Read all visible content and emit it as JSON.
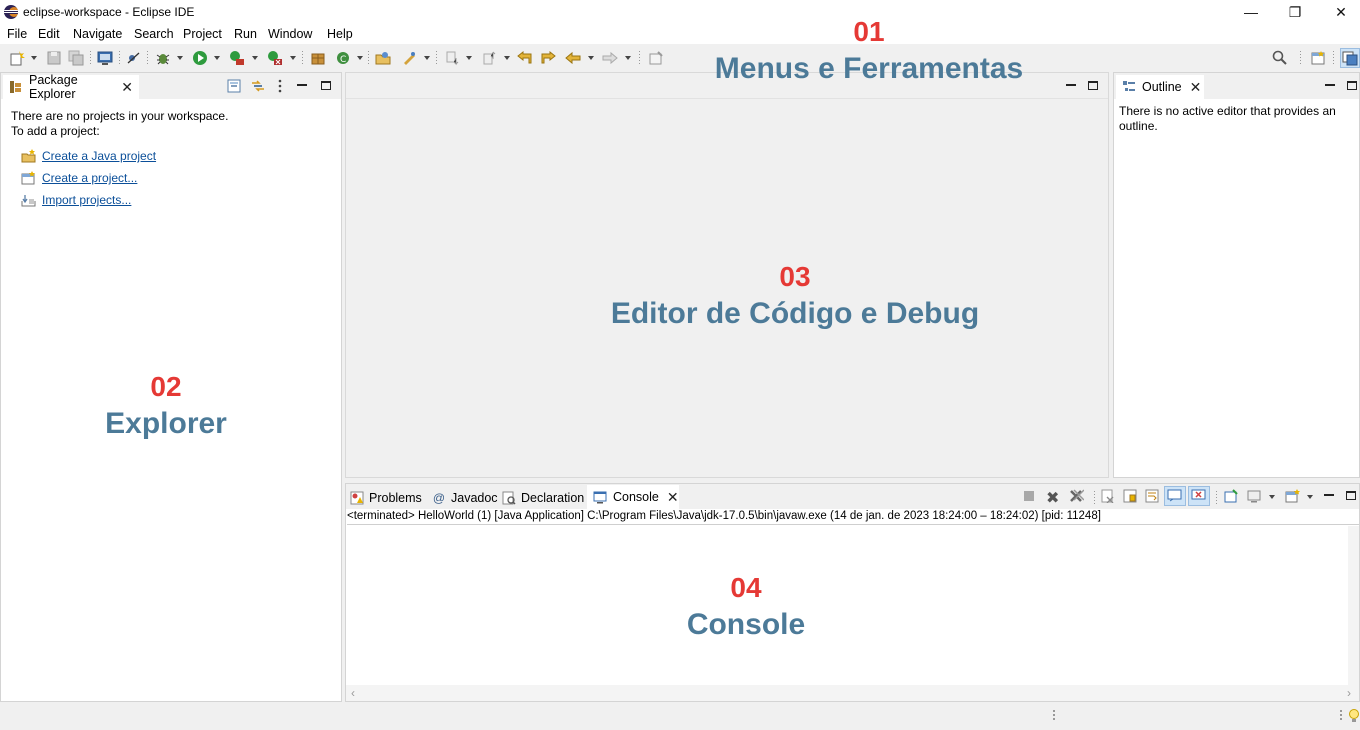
{
  "window": {
    "title": "eclipse-workspace - Eclipse IDE",
    "minimize_glyph": "—",
    "restore_glyph": "❐",
    "close_glyph": "✕"
  },
  "menu": [
    {
      "label": "File"
    },
    {
      "label": "Edit"
    },
    {
      "label": "Navigate"
    },
    {
      "label": "Search"
    },
    {
      "label": "Project"
    },
    {
      "label": "Run"
    },
    {
      "label": "Window"
    },
    {
      "label": "Help"
    }
  ],
  "package_explorer": {
    "tab_label": "Package Explorer",
    "message_line1": "There are no projects in your workspace.",
    "message_line2": "To add a project:",
    "links": [
      {
        "label": "Create a Java project",
        "icon": "new-java-project-icon"
      },
      {
        "label": "Create a project...",
        "icon": "new-project-icon"
      },
      {
        "label": "Import projects...",
        "icon": "import-icon"
      }
    ]
  },
  "outline": {
    "tab_label": "Outline",
    "message": "There is no active editor that provides an outline."
  },
  "bottom_tabs": [
    {
      "label": "Problems",
      "icon": "problems-icon"
    },
    {
      "label": "Javadoc",
      "icon": "at-icon"
    },
    {
      "label": "Declaration",
      "icon": "declaration-icon"
    },
    {
      "label": "Console",
      "icon": "console-icon",
      "active": true
    }
  ],
  "console": {
    "status": "<terminated> HelloWorld (1) [Java Application] C:\\Program Files\\Java\\jdk-17.0.5\\bin\\javaw.exe  (14 de jan. de 2023 18:24:00 – 18:24:02) [pid: 11248]"
  },
  "annotations": {
    "menus_num": "01",
    "menus_label": "Menus e Ferramentas",
    "explorer_num": "02",
    "explorer_label": "Explorer",
    "editor_num": "03",
    "editor_label": "Editor de Código e Debug",
    "console_num": "04",
    "console_label": "Console"
  },
  "colors": {
    "annotation_number": "#e53935",
    "annotation_label": "#4c7a98",
    "link": "#0b4f99"
  }
}
